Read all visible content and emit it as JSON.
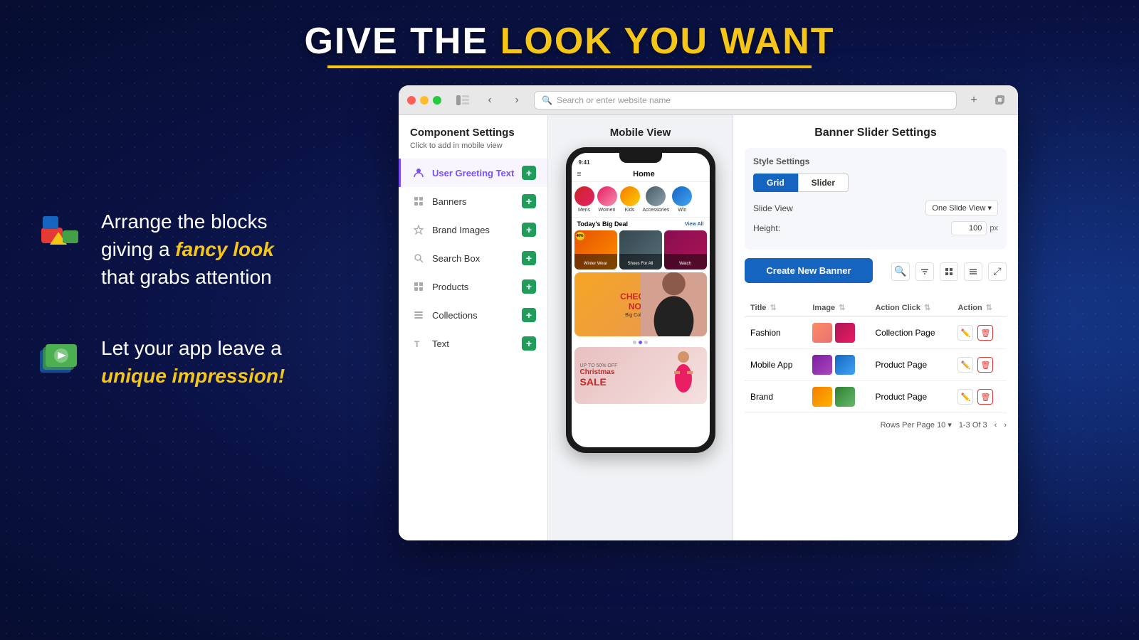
{
  "page": {
    "title": "GIVE THE LOOK YOU WANT",
    "title_highlight": "LOOK YOU WANT",
    "background_color": "#0d1b5e"
  },
  "features": [
    {
      "id": "arrange",
      "text_plain": "Arrange the blocks giving a ",
      "text_highlight": "fancy look",
      "text_suffix": "\nthat grabs attention"
    },
    {
      "id": "impression",
      "text_plain": "Let your app leave a ",
      "text_highlight": "unique impression!",
      "text_suffix": ""
    }
  ],
  "browser": {
    "address_bar_placeholder": "Search or enter website name",
    "address_bar_value": ""
  },
  "component_settings": {
    "title": "Component Settings",
    "subtitle": "Click to add in mobile view",
    "items": [
      {
        "id": "user-greeting",
        "label": "User Greeting Text",
        "icon": "person",
        "active": true
      },
      {
        "id": "banners",
        "label": "Banners",
        "icon": "grid",
        "active": false
      },
      {
        "id": "brand-images",
        "label": "Brand Images",
        "icon": "star",
        "active": false
      },
      {
        "id": "search-box",
        "label": "Search Box",
        "icon": "search",
        "active": false
      },
      {
        "id": "products",
        "label": "Products",
        "icon": "grid4",
        "active": false
      },
      {
        "id": "collections",
        "label": "Collections",
        "icon": "stack",
        "active": false
      },
      {
        "id": "text",
        "label": "Text",
        "icon": "text",
        "active": false
      }
    ]
  },
  "mobile_view": {
    "title": "Mobile View",
    "phone": {
      "home_label": "Home",
      "categories": [
        {
          "label": "Mens"
        },
        {
          "label": "Women"
        },
        {
          "label": "Kids"
        },
        {
          "label": "Accessories"
        },
        {
          "label": "Win"
        }
      ],
      "section_header": "Today's Big Deal",
      "section_link": "View All",
      "products": [
        {
          "label": "Winter Wear"
        },
        {
          "label": "Shoes For All"
        },
        {
          "label": "Watch"
        }
      ],
      "banner_text": "CHECK IT NOW!",
      "banner_sub": "Big Collection",
      "sale_text": "Christmas SALE",
      "sale_sub": "UP TO 50% OFF"
    }
  },
  "banner_settings": {
    "title": "Banner Slider Settings",
    "style_settings_label": "Style Settings",
    "toggle_options": [
      {
        "id": "grid",
        "label": "Grid",
        "active": true
      },
      {
        "id": "slider",
        "label": "Slider",
        "active": false
      }
    ],
    "slide_view_label": "Slide View",
    "slide_view_value": "One Slide View",
    "height_label": "Height:",
    "height_value": "100",
    "height_unit": "px",
    "create_banner_label": "Create New Banner",
    "table": {
      "columns": [
        {
          "id": "title",
          "label": "Title"
        },
        {
          "id": "image",
          "label": "Image"
        },
        {
          "id": "action_click",
          "label": "Action Click"
        },
        {
          "id": "action",
          "label": "Action"
        }
      ],
      "rows": [
        {
          "title": "Fashion",
          "action_click": "Collection Page",
          "thumb1_color": "#ff8a65",
          "thumb2_color": "#ad1457"
        },
        {
          "title": "Mobile App",
          "action_click": "Product Page",
          "thumb1_color": "#7b1fa2",
          "thumb2_color": "#1565c0"
        },
        {
          "title": "Brand",
          "action_click": "Product Page",
          "thumb1_color": "#f57c00",
          "thumb2_color": "#2e7d32"
        }
      ],
      "footer": {
        "rows_per_page_label": "Rows Per Page",
        "rows_per_page_value": "10",
        "pagination": "1-3 Of 3"
      }
    }
  }
}
